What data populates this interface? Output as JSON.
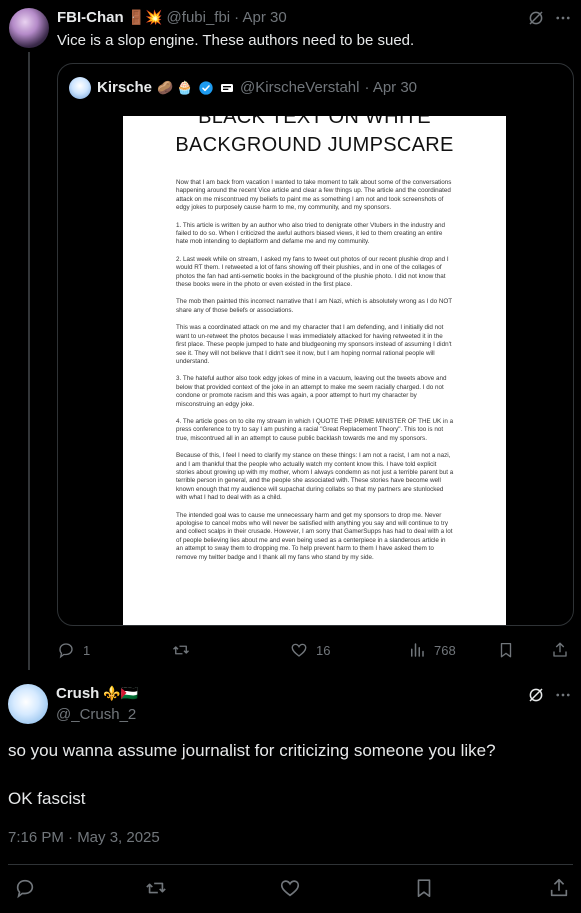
{
  "post": {
    "author_name": "FBI-Chan",
    "author_emoji": "🚪💥",
    "handle": "@fubi_fbi",
    "date": "· Apr 30",
    "text": "Vice is a slop engine. These authors need to be sued.",
    "stats": {
      "replies": "1",
      "retweets": "",
      "likes": "16",
      "views": "768"
    }
  },
  "quote": {
    "author_name": "Kirsche",
    "author_emoji": "🥔 🧁",
    "handle": "@KirscheVerstahl",
    "date": "· Apr 30",
    "image": {
      "title_line1": "BLACK TEXT ON WHITE",
      "title_line2": "BACKGROUND JUMPSCARE",
      "paragraphs": [
        "Now that I am back from vacation I wanted to take moment to talk about some of the conversations happening around the recent Vice article and clear a few things up. The article and the coordinated attack on me miscontrued my beliefs to paint me as something I am not and took screenshots of edgy jokes to purposely cause harm to me, my community, and my sponsors.",
        "1. This article is written by an author who also tried to denigrate other Vtubers in the industry and failed to do so. When I criticized the awful authors biased views, it led to them creating an entire hate mob intending to deplatform and defame me and my community.",
        "2. Last week while on stream, I asked my fans to tweet out photos of our recent plushie drop and I would RT them. I retweeted a lot of fans showing off their plushies, and in one of the collages of photos the fan had anti-semetic books in the background of the plushie photo. I did not know that these books were in the photo or even existed in the first place.",
        "The mob then painted this incorrect narrative that I am Nazi, which is absolutely wrong as I do NOT share any of those beliefs or associations.",
        "This was a coordinated attack on me and my character that I am defending, and I initially did not want to un-retweet the photos because I was immediately attacked for having retweeted it in the first place. These people jumped to hate and bludgeoning my sponsors instead of assuming I didn't see it. They will not believe that I didn't see it now, but I am hoping normal rational people will understand.",
        "3. The hateful author also took edgy jokes of mine in a vacuum, leaving out the tweets above and below that provided context of the joke in an attempt to make me seem racially charged. I do not condone or promote racism and this was again, a poor attempt to hurt my character by misconstruing an edgy joke.",
        "4. The article goes on to cite my stream in which I QUOTE THE PRIME MINISTER OF THE UK in a press conference to try to say I am pushing a racial \"Great Replacement Theory\". This too is not true, miscontrued all in an attempt to cause public backlash towards me and my sponsors.",
        "Because of this, I feel I need to clarify my stance on these things: I am not a racist, I am not a nazi, and I am thankful that the people who actually watch my content know this. I have told explicit stories about growing up with my mother, whom I always condemn as not just a terrible parent but a terrible person in general, and the people she associated with. These stories have become well known enough that my audience will supachat during collabs so that my partners are stunlocked with what I had to deal with as a child.",
        "The intended goal was to cause me unnecessary harm and get my sponsors to drop me. Never apologise to cancel mobs who will never be satisfied with anything you say and will continue to try and collect scalps in their crusade. However, I am sorry that GamerSupps has had to deal with a lot of people believing lies about me and even being used as a centerpiece in a slanderous article in an attempt to sway them to dropping me. To help prevent harm to them I have asked them to remove my twitter badge and I thank all my fans who stand by my side."
      ]
    }
  },
  "reply": {
    "author_name": "Crush",
    "author_emoji": "⚜️🇵🇸",
    "handle": "@_Crush_2",
    "text_line1": "so you wanna assume journalist for criticizing someone you like?",
    "text_line2": "OK fascist",
    "timestamp": "7:16 PM · May 3, 2025"
  },
  "colors": {
    "background": "#000000",
    "text": "#e7e9ea",
    "muted": "#71767b",
    "border": "#2f3336",
    "verified": "#1d9bf0"
  },
  "icons": [
    "grok-icon",
    "more-icon",
    "reply-icon",
    "retweet-icon",
    "like-icon",
    "views-icon",
    "bookmark-icon",
    "share-icon",
    "verified-icon"
  ]
}
